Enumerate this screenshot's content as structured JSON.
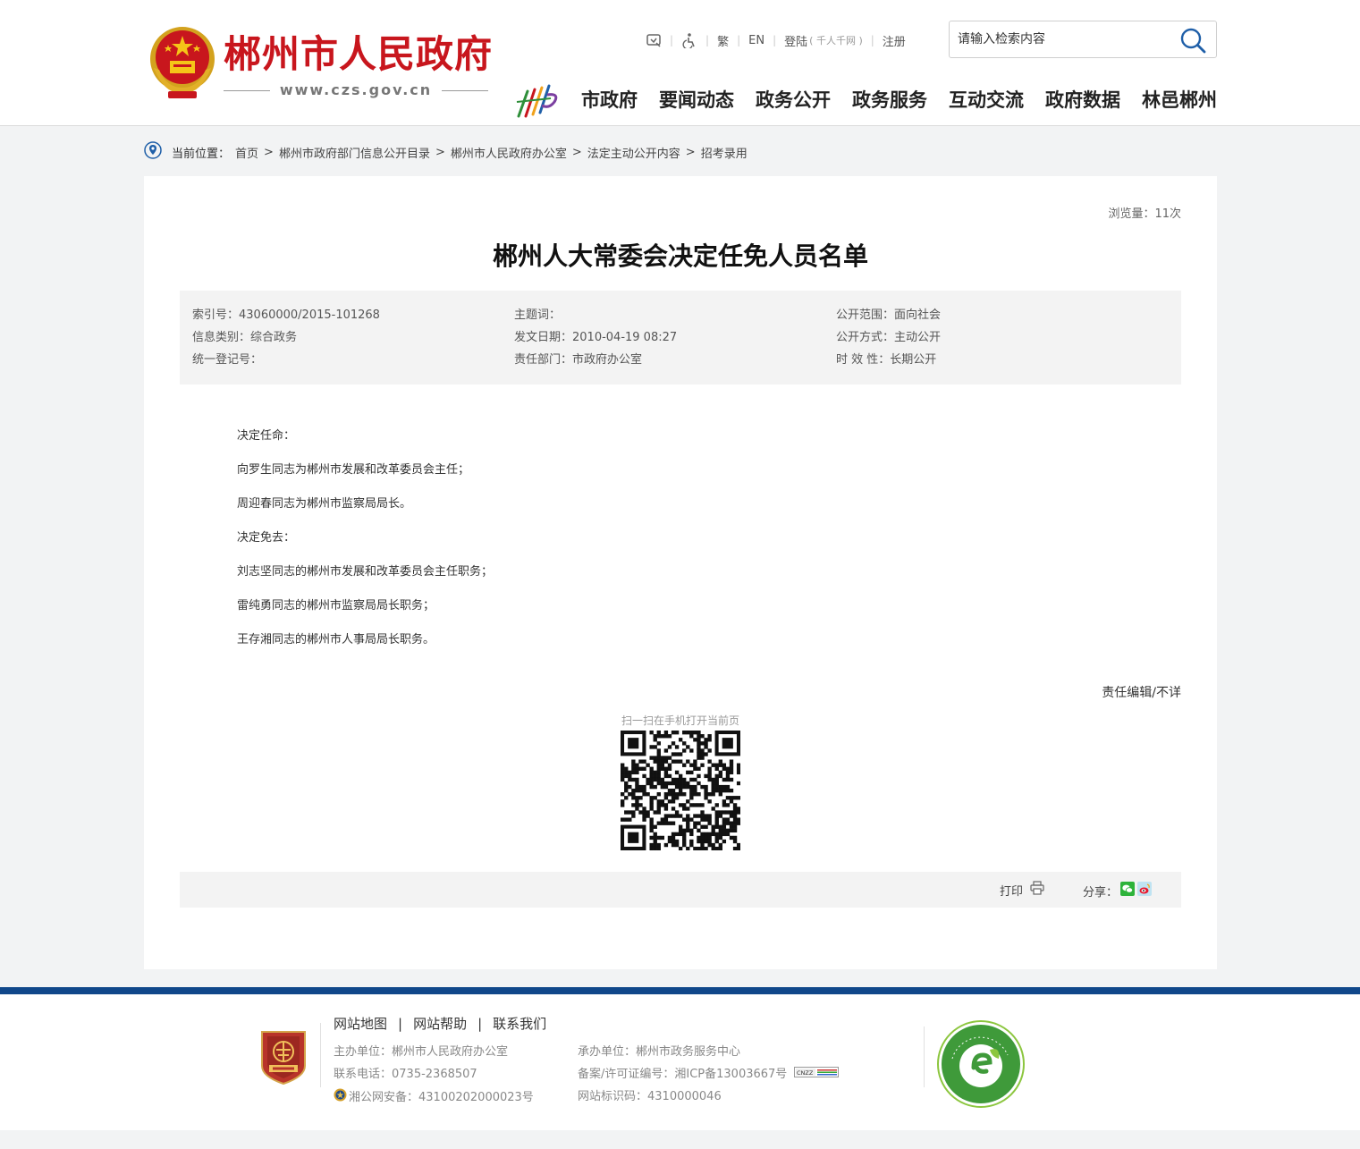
{
  "header": {
    "site_title": "郴州市人民政府",
    "site_url": "www.czs.gov.cn",
    "tools": {
      "traditional": "繁",
      "english": "EN",
      "login": "登陆",
      "login_sub": "( 千人千网 )",
      "register": "注册"
    },
    "search": {
      "placeholder": "请输入检索内容"
    },
    "nav": [
      "市政府",
      "要闻动态",
      "政务公开",
      "政务服务",
      "互动交流",
      "政府数据",
      "林邑郴州"
    ]
  },
  "breadcrumb": {
    "label": "当前位置：",
    "items": [
      "首页",
      "郴州市政府部门信息公开目录",
      "郴州市人民政府办公室",
      "法定主动公开内容",
      "招考录用"
    ],
    "separator": ">"
  },
  "article": {
    "views": "浏览量：11次",
    "title": "郴州人大常委会决定任免人员名单",
    "meta": {
      "index_no": "索引号：43060000/2015-101268",
      "subject": "主题词：",
      "scope": "公开范围：面向社会",
      "category": "信息类别：综合政务",
      "date": "发文日期：2010-04-19 08:27",
      "method": "公开方式：主动公开",
      "reg_no": "统一登记号：",
      "department": "责任部门：市政府办公室",
      "validity": "时 效 性：长期公开"
    },
    "body": [
      "决定任命：",
      "向罗生同志为郴州市发展和改革委员会主任；",
      "周迎春同志为郴州市监察局局长。",
      "决定免去：",
      "刘志坚同志的郴州市发展和改革委员会主任职务；",
      "雷纯勇同志的郴州市监察局局长职务；",
      "王存湘同志的郴州市人事局局长职务。"
    ],
    "editor": "责任编辑/不详",
    "qr_hint": "扫一扫在手机打开当前页",
    "print_label": "打印",
    "share_label": "分享："
  },
  "footer": {
    "links": [
      "网站地图",
      "网站帮助",
      "联系我们"
    ],
    "sponsor": "主办单位：郴州市人民政府办公室",
    "phone": "联系电话：0735-2368507",
    "police": "湘公网安备：43100202000023号",
    "organizer": "承办单位：郴州市政务服务中心",
    "icp": "备案/许可证编号：湘ICP备13003667号",
    "site_code": "网站标识码：4310000046"
  },
  "colors": {
    "brand_red": "#c8161d",
    "footer_blue": "#10478a",
    "search_icon": "#1f5fa8"
  }
}
